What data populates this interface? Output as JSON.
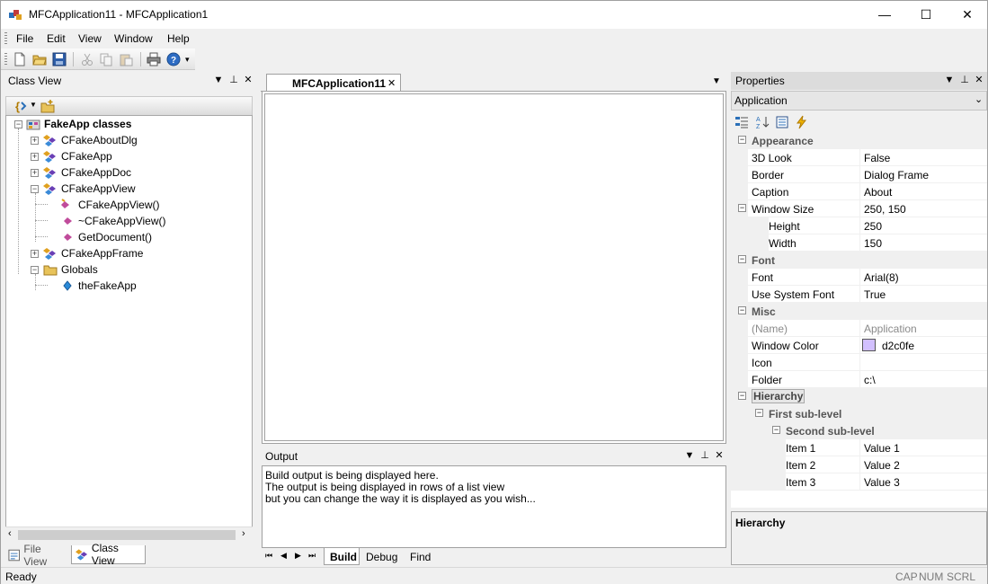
{
  "window": {
    "title": "MFCApplication11 - MFCApplication1",
    "controls": {
      "minimize": "—",
      "maximize": "☐",
      "close": "✕"
    }
  },
  "menu": [
    "File",
    "Edit",
    "View",
    "Window",
    "Help"
  ],
  "toolbar": {
    "icons": [
      "new-icon",
      "open-icon",
      "save-icon",
      "cut-icon",
      "copy-icon",
      "paste-icon",
      "print-icon",
      "help-icon"
    ]
  },
  "class_view": {
    "title": "Class View",
    "tree": {
      "root": "FakeApp classes",
      "items": [
        {
          "label": "CFakeAboutDlg",
          "icon": "class-icon"
        },
        {
          "label": "CFakeApp",
          "icon": "class-icon"
        },
        {
          "label": "CFakeAppDoc",
          "icon": "class-icon"
        },
        {
          "label": "CFakeAppView",
          "icon": "class-icon",
          "children": [
            {
              "label": "CFakeAppView()",
              "icon": "method-icon"
            },
            {
              "label": "~CFakeAppView()",
              "icon": "method-icon"
            },
            {
              "label": "GetDocument()",
              "icon": "method-icon"
            }
          ]
        },
        {
          "label": "CFakeAppFrame",
          "icon": "class-icon"
        },
        {
          "label": "Globals",
          "icon": "folder-icon",
          "children": [
            {
              "label": "theFakeApp",
              "icon": "variable-icon"
            }
          ]
        }
      ]
    },
    "tabs": [
      "File View",
      "Class View"
    ]
  },
  "document": {
    "tab_label": "MFCApplication11"
  },
  "output": {
    "title": "Output",
    "lines": [
      "Build output is being displayed here.",
      "The output is being displayed in rows of a list view",
      "but you can change the way it is displayed as you wish..."
    ],
    "tabs": [
      "Build",
      "Debug",
      "Find"
    ]
  },
  "properties": {
    "title": "Properties",
    "object": "Application",
    "rows": [
      {
        "type": "category",
        "name": "Appearance"
      },
      {
        "type": "prop",
        "name": "3D Look",
        "value": "False"
      },
      {
        "type": "prop",
        "name": "Border",
        "value": "Dialog Frame"
      },
      {
        "type": "prop",
        "name": "Caption",
        "value": "About"
      },
      {
        "type": "prop",
        "name": "Window Size",
        "value": "250, 150"
      },
      {
        "type": "prop",
        "name": "Height",
        "value": "250"
      },
      {
        "type": "prop",
        "name": "Width",
        "value": "150"
      },
      {
        "type": "category",
        "name": "Font"
      },
      {
        "type": "prop",
        "name": "Font",
        "value": "Arial(8)"
      },
      {
        "type": "prop",
        "name": "Use System Font",
        "value": "True"
      },
      {
        "type": "category",
        "name": "Misc"
      },
      {
        "type": "prop",
        "name": "(Name)",
        "value": "Application"
      },
      {
        "type": "prop",
        "name": "Window Color",
        "value": "d2c0fe"
      },
      {
        "type": "prop",
        "name": "Icon",
        "value": ""
      },
      {
        "type": "prop",
        "name": "Folder",
        "value": "c:\\"
      },
      {
        "type": "category",
        "name": "Hierarchy"
      },
      {
        "type": "category",
        "name": "First sub-level"
      },
      {
        "type": "category",
        "name": "Second sub-level"
      },
      {
        "type": "prop",
        "name": "Item 1",
        "value": "Value 1"
      },
      {
        "type": "prop",
        "name": "Item 2",
        "value": "Value 2"
      },
      {
        "type": "prop",
        "name": "Item 3",
        "value": "Value 3"
      }
    ],
    "description_title": "Hierarchy",
    "swatch_color": "#d2c0fe"
  },
  "status": {
    "text": "Ready",
    "indicators": [
      "CAP",
      "NUM",
      "SCRL"
    ]
  }
}
